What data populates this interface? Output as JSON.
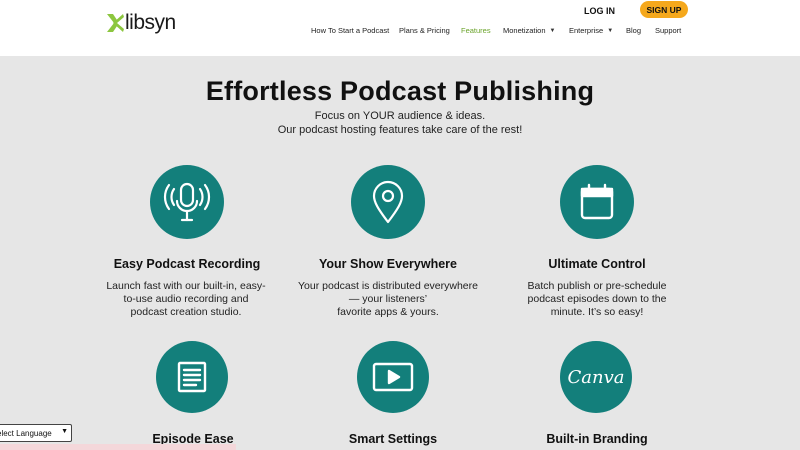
{
  "header": {
    "logo_text": "libsyn",
    "login_label": "LOG IN",
    "signup_label": "SIGN UP",
    "nav": [
      {
        "label": "How To Start a Podcast"
      },
      {
        "label": "Plans & Pricing"
      },
      {
        "label": "Features",
        "active": true
      },
      {
        "label": "Monetization",
        "dropdown": true
      },
      {
        "label": "Enterprise",
        "dropdown": true
      },
      {
        "label": "Blog"
      },
      {
        "label": "Support"
      }
    ]
  },
  "hero": {
    "title": "Effortless Podcast Publishing",
    "subtitle_line1": "Focus on YOUR audience & ideas.",
    "subtitle_line2": "Our podcast hosting features take care of the rest!"
  },
  "features": [
    {
      "icon": "microphone-icon",
      "title": "Easy Podcast Recording",
      "desc": [
        "Launch fast with our built-in, easy-",
        "to-use audio recording and",
        "podcast creation studio."
      ]
    },
    {
      "icon": "location-pin-icon",
      "title": "Your Show Everywhere",
      "desc": [
        "Your podcast is distributed everywhere",
        "— your listeners’",
        "favorite apps & yours."
      ]
    },
    {
      "icon": "calendar-icon",
      "title": "Ultimate Control",
      "desc": [
        "Batch publish or pre-schedule",
        "podcast episodes down to the",
        "minute. It’s so easy!"
      ]
    },
    {
      "icon": "document-icon",
      "title": "Episode Ease",
      "desc": []
    },
    {
      "icon": "play-video-icon",
      "title": "Smart Settings",
      "desc": []
    },
    {
      "icon": "canva-logo-icon",
      "canva_text": "Canva",
      "title": "Built-in Branding",
      "desc": []
    }
  ],
  "language_select": {
    "label": "elect Language"
  },
  "colors": {
    "accent": "#137f7b",
    "signup": "#f5a81c",
    "nav_active": "#6aa32a",
    "logo_green": "#8cc63f"
  }
}
